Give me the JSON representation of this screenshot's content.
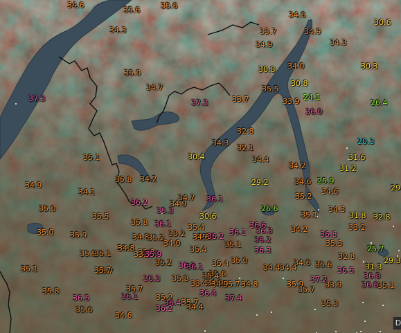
{
  "map": {
    "colors": {
      "hot": "#e7549e",
      "warm": "#e9862d",
      "mild": "#f3d233",
      "cool": "#8ee22f",
      "cold": "#35c8d6",
      "lake": "#3d4f5e",
      "border": "#111111"
    },
    "labels": [
      {
        "v": "34.6",
        "c": "warm"
      },
      {
        "v": "35.6",
        "c": "warm"
      },
      {
        "v": "35.6",
        "c": "warm"
      },
      {
        "v": "34.6",
        "c": "warm"
      },
      {
        "v": "30.6",
        "c": "mild"
      },
      {
        "v": "34.3",
        "c": "warm"
      },
      {
        "v": "33.7",
        "c": "warm"
      },
      {
        "v": "34.9",
        "c": "warm"
      },
      {
        "v": "34.9",
        "c": "warm"
      },
      {
        "v": "34.3",
        "c": "warm"
      },
      {
        "v": "30.8",
        "c": "mild"
      },
      {
        "v": "34.0",
        "c": "warm"
      },
      {
        "v": "30.3",
        "c": "mild"
      },
      {
        "v": "35.9",
        "c": "warm"
      },
      {
        "v": "30.8",
        "c": "mild"
      },
      {
        "v": "34.7",
        "c": "warm"
      },
      {
        "v": "35.5",
        "c": "warm"
      },
      {
        "v": "24.1",
        "c": "cool"
      },
      {
        "v": "37.3",
        "c": "hot"
      },
      {
        "v": "33.7",
        "c": "warm"
      },
      {
        "v": "37.3",
        "c": "hot"
      },
      {
        "v": "33.9",
        "c": "warm"
      },
      {
        "v": "26.4",
        "c": "cool"
      },
      {
        "v": "36.0",
        "c": "hot"
      },
      {
        "v": "32.8",
        "c": "warm"
      },
      {
        "v": "20.3",
        "c": "cold"
      },
      {
        "v": "34.3",
        "c": "warm"
      },
      {
        "v": "32.1",
        "c": "warm"
      },
      {
        "v": "31.6",
        "c": "mild"
      },
      {
        "v": "35.1",
        "c": "warm"
      },
      {
        "v": "30.4",
        "c": "mild"
      },
      {
        "v": "34.4",
        "c": "warm"
      },
      {
        "v": "34.2",
        "c": "warm"
      },
      {
        "v": "31.2",
        "c": "mild"
      },
      {
        "v": "35.8",
        "c": "warm"
      },
      {
        "v": "34.2",
        "c": "warm"
      },
      {
        "v": "29.2",
        "c": "mild"
      },
      {
        "v": "34.6",
        "c": "warm"
      },
      {
        "v": "25.9",
        "c": "cool"
      },
      {
        "v": "34.9",
        "c": "warm"
      },
      {
        "v": "34.1",
        "c": "warm"
      },
      {
        "v": "34.6",
        "c": "warm"
      },
      {
        "v": "29.",
        "c": "mild"
      },
      {
        "v": "34.7",
        "c": "warm"
      },
      {
        "v": "36.1",
        "c": "hot"
      },
      {
        "v": "35.2",
        "c": "warm"
      },
      {
        "v": "36.2",
        "c": "hot"
      },
      {
        "v": "34.9",
        "c": "warm"
      },
      {
        "v": "35.0",
        "c": "warm"
      },
      {
        "v": "35.3",
        "c": "hot"
      },
      {
        "v": "26.6",
        "c": "cool"
      },
      {
        "v": "34.3",
        "c": "warm"
      },
      {
        "v": "35.5",
        "c": "warm"
      },
      {
        "v": "30.6",
        "c": "mild"
      },
      {
        "v": "35.1",
        "c": "warm"
      },
      {
        "v": "31.8",
        "c": "mild"
      },
      {
        "v": "32.8",
        "c": "mild"
      },
      {
        "v": "35.8",
        "c": "warm"
      },
      {
        "v": "36.1",
        "c": "hot"
      },
      {
        "v": "36.6",
        "c": "hot"
      },
      {
        "v": "33.2",
        "c": "warm"
      },
      {
        "v": "35.4",
        "c": "warm"
      },
      {
        "v": "36.1",
        "c": "hot"
      },
      {
        "v": "33.2",
        "c": "warm"
      },
      {
        "v": "34.2",
        "c": "warm"
      },
      {
        "v": "35.0",
        "c": "warm"
      },
      {
        "v": "35.9",
        "c": "warm"
      },
      {
        "v": "36.3",
        "c": "hot"
      },
      {
        "v": "36.8",
        "c": "hot"
      },
      {
        "v": "34.8",
        "c": "warm"
      },
      {
        "v": "35.2",
        "c": "warm"
      },
      {
        "v": "34.6",
        "c": "warm"
      },
      {
        "v": "36.2",
        "c": "hot"
      },
      {
        "v": "35.9",
        "c": "warm"
      },
      {
        "v": "35.0",
        "c": "warm"
      },
      {
        "v": "34.0",
        "c": "warm"
      },
      {
        "v": "35.3",
        "c": "warm"
      },
      {
        "v": "35.1",
        "c": "warm"
      },
      {
        "v": "35.9",
        "c": "warm"
      },
      {
        "v": "35.1",
        "c": "warm"
      },
      {
        "v": "36.2",
        "c": "hot"
      },
      {
        "v": "35.8",
        "c": "warm"
      },
      {
        "v": "35.4",
        "c": "warm"
      },
      {
        "v": "36.3",
        "c": "hot"
      },
      {
        "v": "36.3",
        "c": "hot"
      },
      {
        "v": "32.8",
        "c": "warm"
      },
      {
        "v": "25.7",
        "c": "cool"
      },
      {
        "v": "33.9",
        "c": "warm"
      },
      {
        "v": "35.9",
        "c": "hot"
      },
      {
        "v": "34.4",
        "c": "warm"
      },
      {
        "v": "36.5",
        "c": "hot"
      },
      {
        "v": "35.7",
        "c": "warm"
      },
      {
        "v": "34.8",
        "c": "warm"
      },
      {
        "v": "35.2",
        "c": "warm"
      },
      {
        "v": "34.6",
        "c": "warm"
      },
      {
        "v": "35.4",
        "c": "warm"
      },
      {
        "v": "35.0",
        "c": "warm"
      },
      {
        "v": "35.6",
        "c": "warm"
      },
      {
        "v": "31.3",
        "c": "mild"
      },
      {
        "v": "29.3",
        "c": "mild"
      },
      {
        "v": "36.2",
        "c": "hot"
      },
      {
        "v": "36.1",
        "c": "hot"
      },
      {
        "v": "35.6",
        "c": "warm"
      },
      {
        "v": "34.4",
        "c": "warm"
      },
      {
        "v": "35.1",
        "c": "warm"
      },
      {
        "v": "35.7",
        "c": "warm"
      },
      {
        "v": "36.3",
        "c": "hot"
      },
      {
        "v": "35.8",
        "c": "warm"
      },
      {
        "v": "35.4",
        "c": "warm"
      },
      {
        "v": "34.9",
        "c": "warm"
      },
      {
        "v": "35.7",
        "c": "warm"
      },
      {
        "v": "36.8",
        "c": "hot"
      },
      {
        "v": "33.4",
        "c": "warm"
      },
      {
        "v": "34.9",
        "c": "warm"
      },
      {
        "v": "34.8",
        "c": "warm"
      },
      {
        "v": "35.9",
        "c": "warm"
      },
      {
        "v": "37.2",
        "c": "hot"
      },
      {
        "v": "36.6",
        "c": "hot"
      },
      {
        "v": "35.1",
        "c": "warm"
      },
      {
        "v": "35.8",
        "c": "warm"
      },
      {
        "v": "35.7",
        "c": "warm"
      },
      {
        "v": "35.7",
        "c": "warm"
      },
      {
        "v": "36.5",
        "c": "hot"
      },
      {
        "v": "36.1",
        "c": "hot"
      },
      {
        "v": "35.2",
        "c": "warm"
      },
      {
        "v": "37.4",
        "c": "hot"
      },
      {
        "v": "36.4",
        "c": "hot"
      },
      {
        "v": "33.9",
        "c": "warm"
      },
      {
        "v": "36.4",
        "c": "hot"
      },
      {
        "v": "35.6",
        "c": "warm"
      },
      {
        "v": "35.7",
        "c": "warm"
      },
      {
        "v": "34.4",
        "c": "warm"
      },
      {
        "v": "36.2",
        "c": "hot"
      },
      {
        "v": "35.3",
        "c": "warm"
      },
      {
        "v": "34.6",
        "c": "warm"
      }
    ],
    "corner_button": "D"
  }
}
